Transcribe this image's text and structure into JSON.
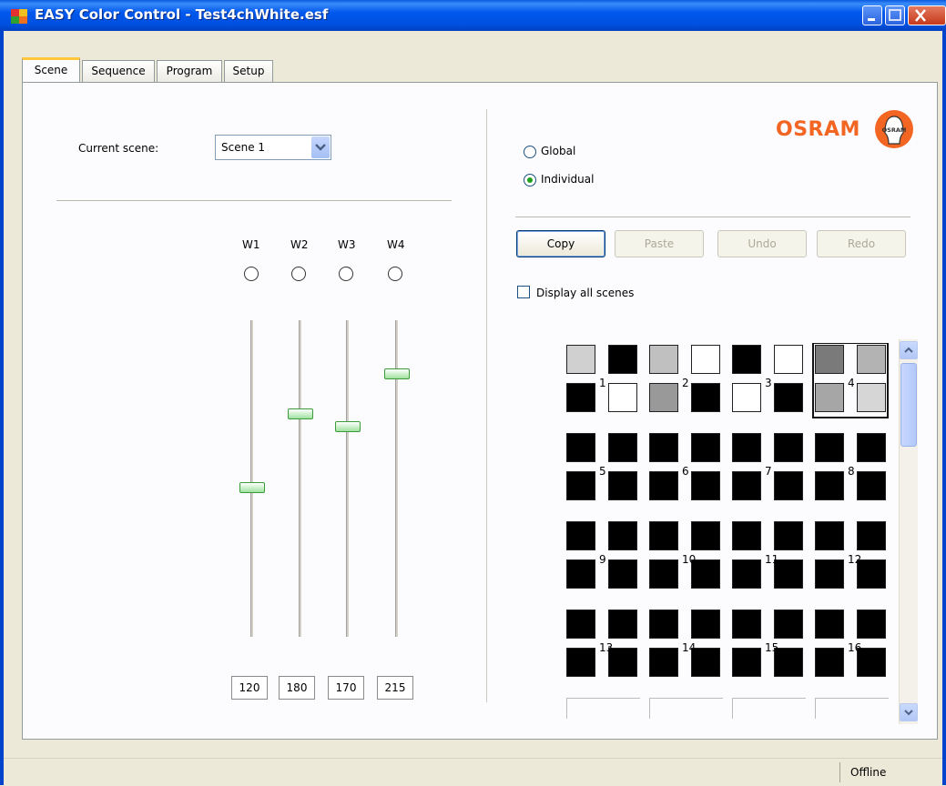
{
  "window": {
    "title": "EASY Color Control - Test4chWhite.esf"
  },
  "tabs": [
    {
      "label": "Scene",
      "active": true
    },
    {
      "label": "Sequence",
      "active": false
    },
    {
      "label": "Program",
      "active": false
    },
    {
      "label": "Setup",
      "active": false
    }
  ],
  "scene": {
    "current_label": "Current scene:",
    "current_value": "Scene 1"
  },
  "channels": [
    {
      "name": "W1",
      "value": "120",
      "level": 0.47
    },
    {
      "name": "W2",
      "value": "180",
      "level": 0.71
    },
    {
      "name": "W3",
      "value": "170",
      "level": 0.67
    },
    {
      "name": "W4",
      "value": "215",
      "level": 0.84
    }
  ],
  "mode": {
    "options": [
      "Global",
      "Individual"
    ],
    "selected": "Individual"
  },
  "actions": {
    "copy": "Copy",
    "paste": "Paste",
    "undo": "Undo",
    "redo": "Redo"
  },
  "display_all": {
    "label": "Display all scenes",
    "checked": false
  },
  "brand": {
    "logo_text": "OSRAM",
    "bulb_text": "OSRAM"
  },
  "scene_grid": {
    "selected_scene": 4,
    "scenes": [
      {
        "label": "1",
        "colors": [
          "#d0d0d0",
          "#000000",
          "#000000",
          "#ffffff"
        ]
      },
      {
        "label": "2",
        "colors": [
          "#c0c0c0",
          "#ffffff",
          "#999999",
          "#000000"
        ]
      },
      {
        "label": "3",
        "colors": [
          "#000000",
          "#ffffff",
          "#ffffff",
          "#000000"
        ]
      },
      {
        "label": "4",
        "colors": [
          "#7a7a7a",
          "#b3b3b3",
          "#a6a6a6",
          "#d6d6d6"
        ]
      },
      {
        "label": "5",
        "colors": [
          "#000000",
          "#000000",
          "#000000",
          "#000000"
        ]
      },
      {
        "label": "6",
        "colors": [
          "#000000",
          "#000000",
          "#000000",
          "#000000"
        ]
      },
      {
        "label": "7",
        "colors": [
          "#000000",
          "#000000",
          "#000000",
          "#000000"
        ]
      },
      {
        "label": "8",
        "colors": [
          "#000000",
          "#000000",
          "#000000",
          "#000000"
        ]
      },
      {
        "label": "9",
        "colors": [
          "#000000",
          "#000000",
          "#000000",
          "#000000"
        ]
      },
      {
        "label": "10",
        "colors": [
          "#000000",
          "#000000",
          "#000000",
          "#000000"
        ]
      },
      {
        "label": "11",
        "colors": [
          "#000000",
          "#000000",
          "#000000",
          "#000000"
        ]
      },
      {
        "label": "12",
        "colors": [
          "#000000",
          "#000000",
          "#000000",
          "#000000"
        ]
      },
      {
        "label": "13",
        "colors": [
          "#000000",
          "#000000",
          "#000000",
          "#000000"
        ]
      },
      {
        "label": "14",
        "colors": [
          "#000000",
          "#000000",
          "#000000",
          "#000000"
        ]
      },
      {
        "label": "15",
        "colors": [
          "#000000",
          "#000000",
          "#000000",
          "#000000"
        ]
      },
      {
        "label": "16",
        "colors": [
          "#000000",
          "#000000",
          "#000000",
          "#000000"
        ]
      }
    ]
  },
  "status": {
    "text": "Offline"
  },
  "colors": {
    "accent": "#f26522",
    "title_bar": "#0058ee",
    "tab_highlight": "#ffc83c"
  }
}
